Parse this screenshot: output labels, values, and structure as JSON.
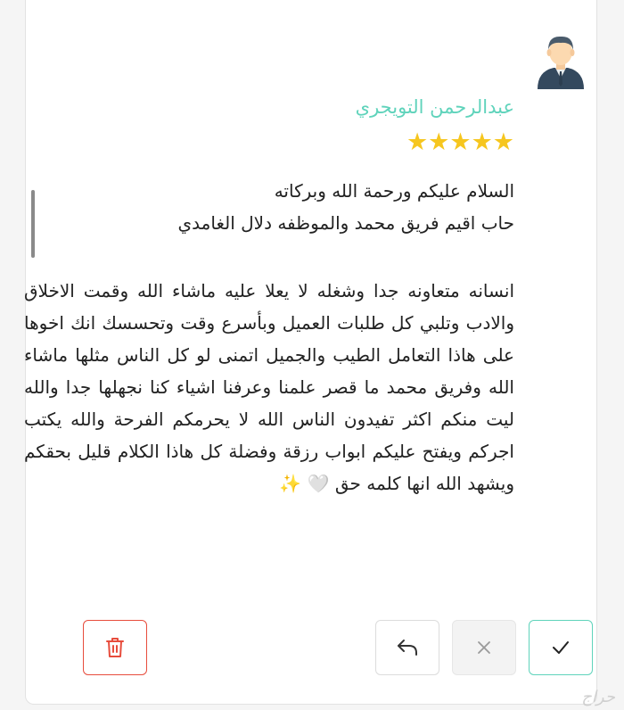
{
  "review": {
    "author_name": "عبدالرحمن التويجري",
    "stars": "★★★★★",
    "greeting_line1": "السلام عليكم ورحمة الله وبركاته",
    "greeting_line2": "حاب اقيم فريق محمد والموظفه دلال الغامدي",
    "body": "انسانه متعاونه جدا وشغله لا يعلا عليه ماشاء الله وقمت الاخلاق والادب وتلبي كل طلبات العميل وبأسرع وقت وتحسسك انك اخوها على هاذا التعامل الطيب والجميل اتمنى لو كل الناس مثلها ماشاء الله وفريق محمد ما قصر علمنا وعرفنا اشياء كنا نجهلها جدا والله ليت منكم اكثر تفيدون الناس الله لا يحرمكم الفرحة والله يكتب اجركم ويفتح عليكم ابواب رزقة وفضلة كل هاذا الكلام قليل بحقكم ويشهد الله انها كلمه حق 🤍 ✨"
  },
  "actions": {
    "delete_icon": "trash-icon",
    "reply_icon": "reply-icon",
    "reject_icon": "close-icon",
    "approve_icon": "check-icon"
  },
  "watermark": "حراج",
  "colors": {
    "accent": "#5fd3bb",
    "danger": "#e74c3c",
    "star": "#f6c61f"
  }
}
